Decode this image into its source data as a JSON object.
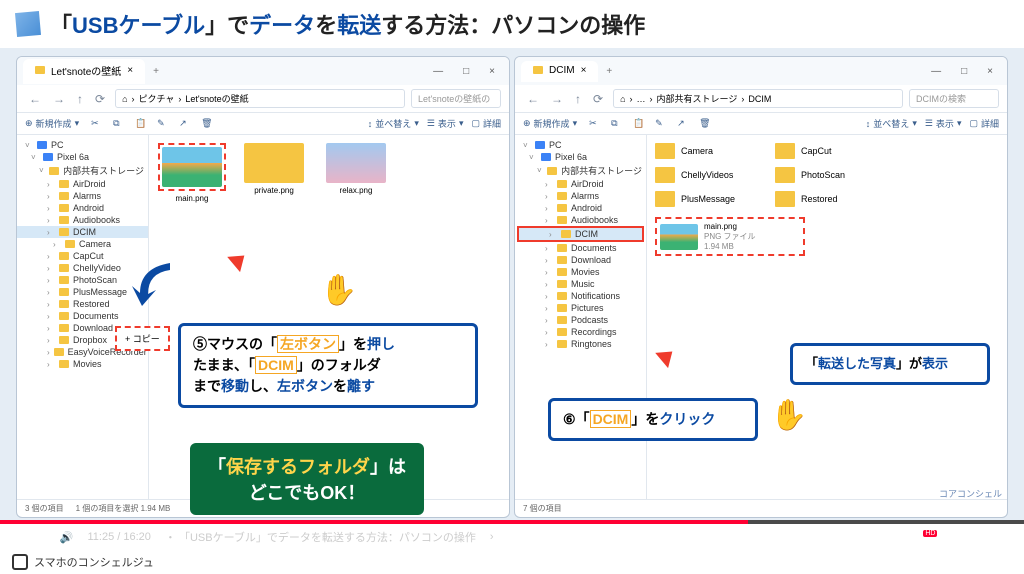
{
  "header": {
    "title_html": "「<b>USBケーブル</b>」で<b>データ</b>を<b>転送</b>する方法：パソコンの操作"
  },
  "left_explorer": {
    "tab": "Let'snoteの壁紙",
    "breadcrumb": [
      "ピクチャ",
      "Let'snoteの壁紙"
    ],
    "search_ph": "Let'snoteの壁紙の",
    "toolbar": {
      "new": "新規作成",
      "sort": "並べ替え",
      "view": "表示",
      "details": "詳細"
    },
    "tree": [
      {
        "l": 0,
        "t": "pc",
        "label": "PC"
      },
      {
        "l": 1,
        "t": "pc",
        "label": "Pixel 6a"
      },
      {
        "l": 2,
        "t": "dr",
        "label": "内部共有ストレージ"
      },
      {
        "l": 3,
        "t": "f",
        "label": "AirDroid"
      },
      {
        "l": 3,
        "t": "f",
        "label": "Alarms"
      },
      {
        "l": 3,
        "t": "f",
        "label": "Android"
      },
      {
        "l": 3,
        "t": "f",
        "label": "Audiobooks"
      },
      {
        "l": 3,
        "t": "f",
        "label": "DCIM",
        "sel": true
      },
      {
        "l": 4,
        "t": "f",
        "label": "Camera"
      },
      {
        "l": 3,
        "t": "f",
        "label": "CapCut"
      },
      {
        "l": 3,
        "t": "f",
        "label": "ChellyVideo"
      },
      {
        "l": 3,
        "t": "f",
        "label": "PhotoScan"
      },
      {
        "l": 3,
        "t": "f",
        "label": "PlusMessage"
      },
      {
        "l": 3,
        "t": "f",
        "label": "Restored"
      },
      {
        "l": 3,
        "t": "f",
        "label": "Documents"
      },
      {
        "l": 3,
        "t": "f",
        "label": "Download"
      },
      {
        "l": 3,
        "t": "f",
        "label": "Dropbox"
      },
      {
        "l": 3,
        "t": "f",
        "label": "EasyVoiceRecorder"
      },
      {
        "l": 3,
        "t": "f",
        "label": "Movies"
      }
    ],
    "files": [
      {
        "name": "main.png",
        "cls": "grad1",
        "sel": true
      },
      {
        "name": "private.png",
        "cls": "grad2"
      },
      {
        "name": "relax.png",
        "cls": "grad3"
      }
    ],
    "status": {
      "count": "3 個の項目",
      "sel": "1 個の項目を選択 1.94 MB"
    },
    "copy_tip": "+ コピー"
  },
  "right_explorer": {
    "tab": "DCIM",
    "breadcrumb": [
      "…",
      "内部共有ストレージ",
      "DCIM"
    ],
    "search_ph": "DCIMの検索",
    "toolbar": {
      "new": "新規作成",
      "sort": "並べ替え",
      "view": "表示",
      "details": "詳細"
    },
    "tree": [
      {
        "l": 0,
        "t": "pc",
        "label": "PC"
      },
      {
        "l": 1,
        "t": "pc",
        "label": "Pixel 6a"
      },
      {
        "l": 2,
        "t": "dr",
        "label": "内部共有ストレージ"
      },
      {
        "l": 3,
        "t": "f",
        "label": "AirDroid"
      },
      {
        "l": 3,
        "t": "f",
        "label": "Alarms"
      },
      {
        "l": 3,
        "t": "f",
        "label": "Android"
      },
      {
        "l": 3,
        "t": "f",
        "label": "Audiobooks"
      },
      {
        "l": 3,
        "t": "f",
        "label": "DCIM",
        "hi": true
      },
      {
        "l": 3,
        "t": "f",
        "label": "Documents"
      },
      {
        "l": 3,
        "t": "f",
        "label": "Download"
      },
      {
        "l": 3,
        "t": "f",
        "label": "Movies"
      },
      {
        "l": 3,
        "t": "f",
        "label": "Music"
      },
      {
        "l": 3,
        "t": "f",
        "label": "Notifications"
      },
      {
        "l": 3,
        "t": "f",
        "label": "Pictures"
      },
      {
        "l": 3,
        "t": "f",
        "label": "Podcasts"
      },
      {
        "l": 3,
        "t": "f",
        "label": "Recordings"
      },
      {
        "l": 3,
        "t": "f",
        "label": "Ringtones"
      }
    ],
    "folders_col1": [
      "Camera",
      "ChellyVideos",
      "PlusMessage"
    ],
    "folders_col2": [
      "CapCut",
      "PhotoScan",
      "Restored"
    ],
    "main_file": {
      "name": "main.png",
      "type": "PNG ファイル",
      "size": "1.94 MB"
    },
    "status": {
      "count": "7 個の項目"
    }
  },
  "callouts": {
    "c5": "⑤マウスの「<span class='kw-y'>左ボタン</span>」を<span class='kw-b'>押し</span><br>たまま、「<span class='kw-y'>DCIM</span>」のフォルダ<br>まで<span class='kw-b'>移動</span>し、<span class='kw-b'>左ボタン</span>を<span class='kw-b'>離す</span>",
    "green": "「<span class='y'>保存するフォルダ</span>」は<br>どこでもOK！",
    "c6": "⑥「<span class='kw-y'>DCIM</span>」を<span class='kw-b'>クリック</span>",
    "c_photo": "「<span class='kw-b'>転送した写真</span>」が<span class='kw-b'>表示</span>"
  },
  "video": {
    "time": "11:25 / 16:20",
    "chapter": "・ 「USBケーブル」でデータを転送する方法：パソコンの操作",
    "hd": "HD"
  },
  "footer": {
    "brand": "スマホのコンシェルジュ"
  },
  "watermark": "コアコンシェル"
}
